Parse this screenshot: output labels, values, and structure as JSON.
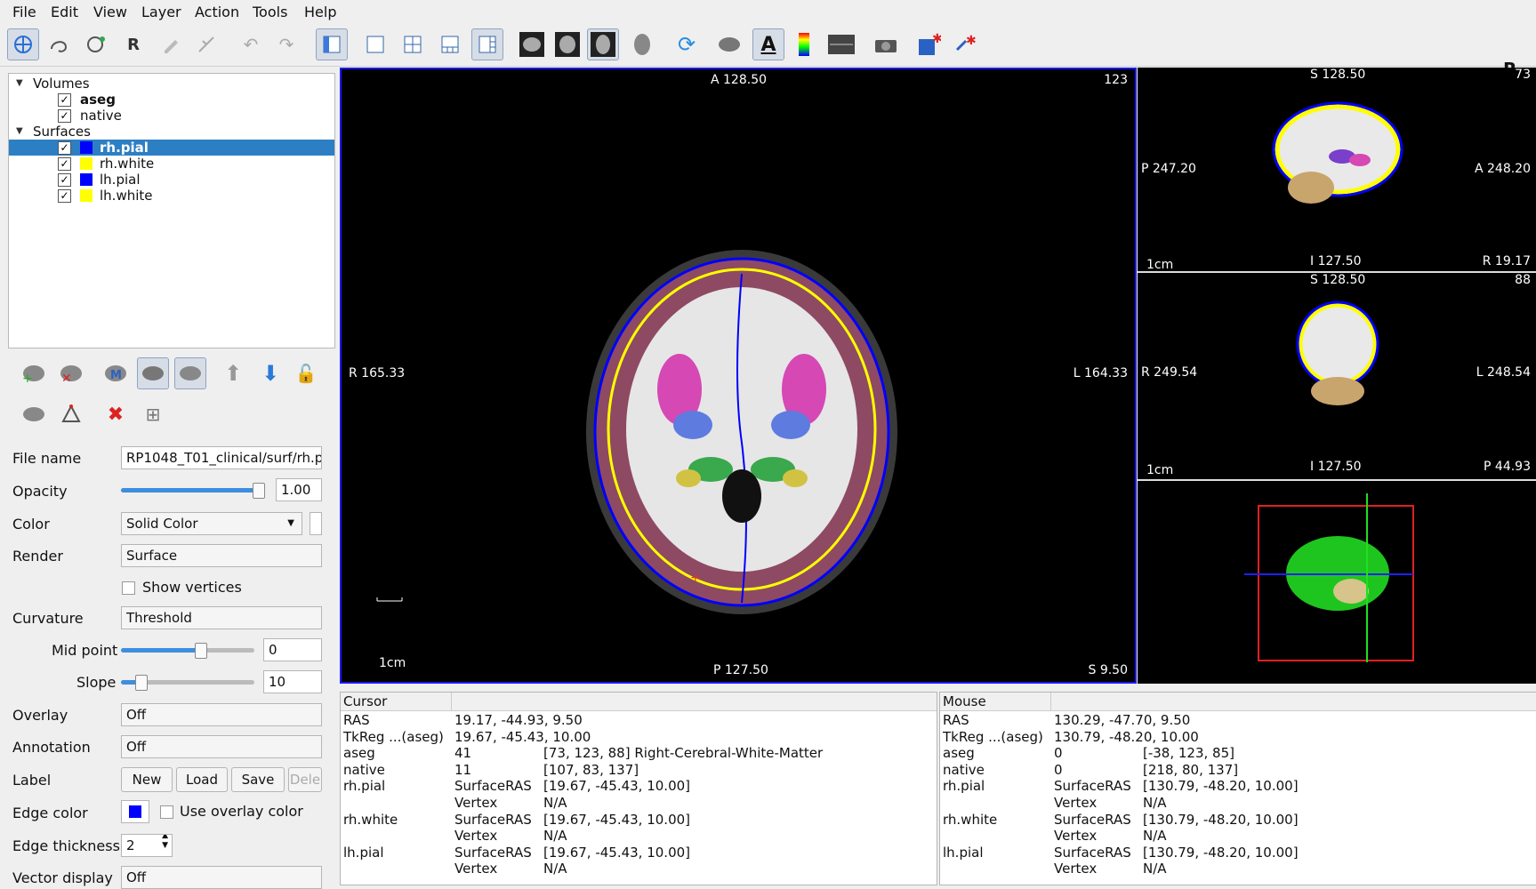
{
  "menu": [
    "File",
    "Edit",
    "View",
    "Layer",
    "Action",
    "Tools",
    "Help"
  ],
  "toolbar": {
    "r_label": "R"
  },
  "layers": {
    "volumes_label": "Volumes",
    "volumes": [
      {
        "name": "aseg"
      },
      {
        "name": "native"
      }
    ],
    "surfaces_label": "Surfaces",
    "surfaces": [
      {
        "name": "rh.pial",
        "color": "#0000ff"
      },
      {
        "name": "rh.white",
        "color": "#ffff00"
      },
      {
        "name": "lh.pial",
        "color": "#0000ff"
      },
      {
        "name": "lh.white",
        "color": "#ffff00"
      }
    ]
  },
  "props": {
    "file_name_label": "File name",
    "file_name": "RP1048_T01_clinical/surf/rh.p",
    "opacity_label": "Opacity",
    "opacity": "1.00",
    "color_label": "Color",
    "color": "Solid Color",
    "render_label": "Render",
    "render": "Surface",
    "show_vertices": "Show vertices",
    "curvature_label": "Curvature",
    "curvature": "Threshold",
    "midpoint_label": "Mid point",
    "midpoint": "0",
    "slope_label": "Slope",
    "slope": "10",
    "overlay_label": "Overlay",
    "overlay": "Off",
    "annotation_label": "Annotation",
    "annotation": "Off",
    "label_label": "Label",
    "new": "New",
    "load": "Load",
    "save": "Save",
    "delete": "Dele",
    "edge_color_label": "Edge color",
    "use_overlay_color": "Use overlay color",
    "edge_thickness_label": "Edge thickness",
    "edge_thickness": "2",
    "vector_display_label": "Vector display",
    "vector_display": "Off",
    "edge_color": "#0000ff"
  },
  "main_view": {
    "top": "A 128.50",
    "bottom": "P 127.50",
    "left": "R 165.33",
    "right": "L 164.33",
    "slice": "123",
    "corner": "S 9.50",
    "scale": "1cm"
  },
  "sagittal_view": {
    "top": "S 128.50",
    "slice": "73",
    "left": "P 247.20",
    "right": "A 248.20",
    "bottom": "I 127.50",
    "corner": "R 19.17",
    "scale": "1cm"
  },
  "coronal_view": {
    "top": "S 128.50",
    "slice": "88",
    "left": "R 249.54",
    "right": "L 248.54",
    "bottom": "I 127.50",
    "corner": "P 44.93",
    "scale": "1cm"
  },
  "cursor_panel": {
    "header": "Cursor",
    "rows": [
      [
        "RAS",
        "19.17, -44.93, 9.50",
        ""
      ],
      [
        "TkReg ...(aseg)",
        "19.67, -45.43, 10.00",
        ""
      ],
      [
        "aseg",
        "41",
        "[73, 123, 88]  Right-Cerebral-White-Matter"
      ],
      [
        "native",
        "11",
        "[107, 83, 137]"
      ],
      [
        "rh.pial",
        "SurfaceRAS",
        "[19.67, -45.43, 10.00]"
      ],
      [
        "",
        "Vertex",
        "N/A"
      ],
      [
        "rh.white",
        "SurfaceRAS",
        "[19.67, -45.43, 10.00]"
      ],
      [
        "",
        "Vertex",
        "N/A"
      ],
      [
        "lh.pial",
        "SurfaceRAS",
        "[19.67, -45.43, 10.00]"
      ],
      [
        "",
        "Vertex",
        "N/A"
      ]
    ]
  },
  "mouse_panel": {
    "header": "Mouse",
    "rows": [
      [
        "RAS",
        "130.29, -47.70, 9.50",
        ""
      ],
      [
        "TkReg ...(aseg)",
        "130.79, -48.20, 10.00",
        ""
      ],
      [
        "aseg",
        "0",
        "[-38, 123, 85]"
      ],
      [
        "native",
        "0",
        "[218, 80, 137]"
      ],
      [
        "rh.pial",
        "SurfaceRAS",
        "[130.79, -48.20, 10.00]"
      ],
      [
        "",
        "Vertex",
        "N/A"
      ],
      [
        "rh.white",
        "SurfaceRAS",
        "[130.79, -48.20, 10.00]"
      ],
      [
        "",
        "Vertex",
        "N/A"
      ],
      [
        "lh.pial",
        "SurfaceRAS",
        "[130.79, -48.20, 10.00]"
      ],
      [
        "",
        "Vertex",
        "N/A"
      ]
    ]
  }
}
